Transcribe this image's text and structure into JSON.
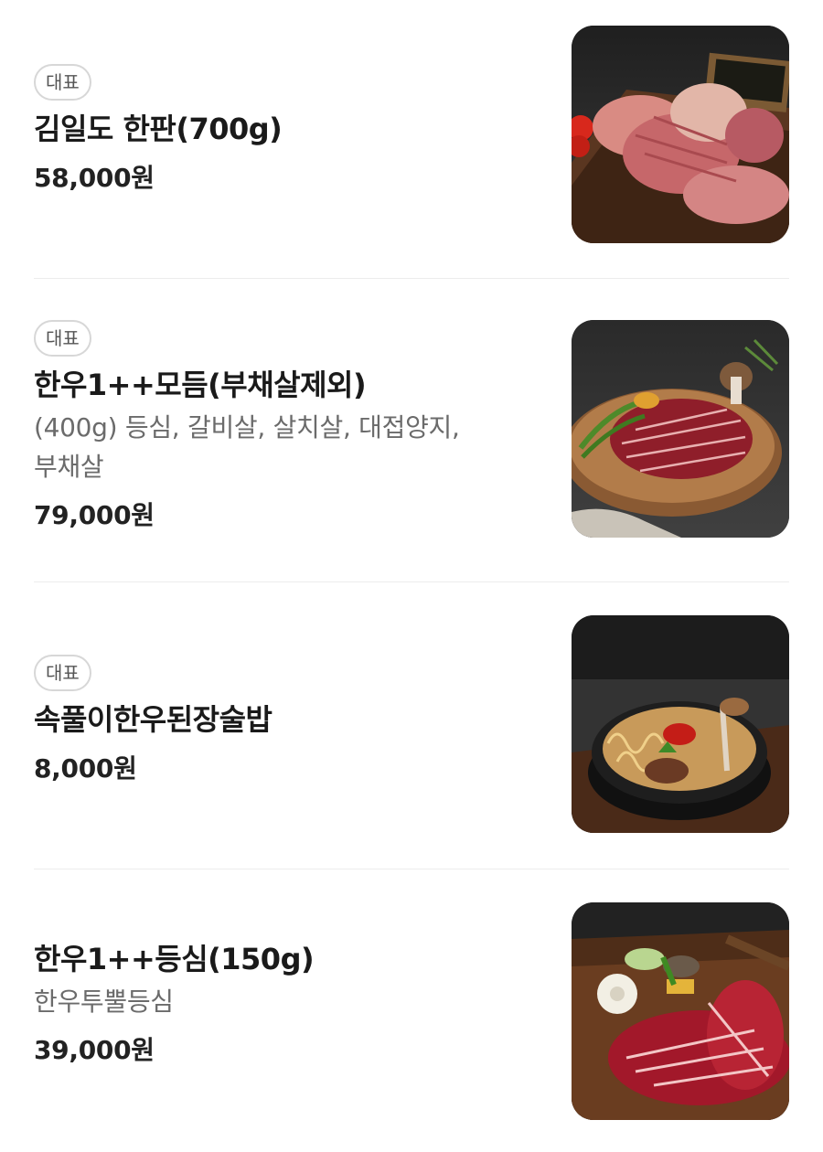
{
  "menu": {
    "items": [
      {
        "badge": "대표",
        "name": "김일도 한판(700g)",
        "price": "58,000원",
        "image_alt": "raw pork and beef cuts on wooden board"
      },
      {
        "badge": "대표",
        "name": "한우1++모듬(부채살제외)",
        "description_line1": "(400g) 등심, 갈비살, 살치살, 대접양지,",
        "description_line2": "부채살",
        "price": "79,000원",
        "image_alt": "marbled hanwoo beef slices on round wooden board"
      },
      {
        "badge": "대표",
        "name": "속풀이한우된장술밥",
        "price": "8,000원",
        "image_alt": "doenjang stew with noodles in black stone bowl"
      },
      {
        "name": "한우1++등심(150g)",
        "description": "한우투뿔등심",
        "price": "39,000원",
        "image_alt": "marbled sirloin with vegetables on wooden board"
      }
    ]
  },
  "colors": {
    "text_primary": "#1a1a1a",
    "text_secondary": "#6b6b6b",
    "badge_border": "#d7d7d7",
    "divider": "#ececec",
    "photo_background": "#2d2d2d"
  }
}
